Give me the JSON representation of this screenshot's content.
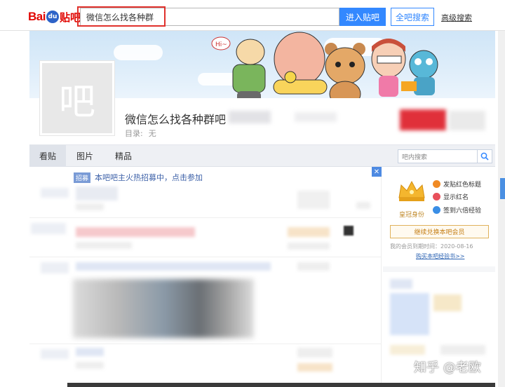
{
  "header": {
    "logo_text_bai": "Bai",
    "logo_text_du": "du",
    "logo_text_tieba": "贴吧",
    "search_value": "微信怎么找各种群",
    "enter_button": "进入贴吧",
    "all_search_button": "全吧搜索",
    "advanced_link": "高级搜索"
  },
  "forum": {
    "avatar_char": "吧",
    "title": "微信怎么找各种群吧",
    "catalog_label": "目录:",
    "catalog_value": "无"
  },
  "nav": {
    "tabs": [
      {
        "label": "看贴"
      },
      {
        "label": "图片"
      },
      {
        "label": "精品"
      }
    ],
    "search_placeholder": "吧内搜索",
    "search_icon": "search-icon"
  },
  "posts": {
    "recruit_tag": "招募",
    "recruit_text": "本吧吧主火热招募中，点击参加",
    "close_icon": "close-icon"
  },
  "sidebar": {
    "crown_label": "皇冠身份",
    "perks": [
      {
        "label": "发贴红色标题",
        "color": "#f08a24"
      },
      {
        "label": "显示红名",
        "color": "#e8505b"
      },
      {
        "label": "签到六倍经验",
        "color": "#3a8ee6"
      }
    ],
    "renew_button": "继续兑换本吧会员",
    "expire_text": "我的会员到期时间：2020-08-16",
    "buy_link": "购买本吧经验书>>"
  },
  "watermark": "知乎 @老欧"
}
